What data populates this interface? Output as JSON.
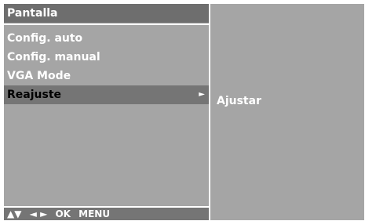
{
  "menu": {
    "title": "Pantalla",
    "items": [
      {
        "label": "Config. auto"
      },
      {
        "label": "Config. manual"
      },
      {
        "label": "VGA Mode"
      },
      {
        "label": "Reajuste",
        "selected": true
      }
    ]
  },
  "submenu": {
    "label": "Ajustar"
  },
  "footer": {
    "updown": "▲▼",
    "leftright": "◄ ►",
    "ok": "OK",
    "menu": "MENU"
  },
  "icons": {
    "submenu_arrow": "►"
  },
  "colors": {
    "panel": "#a5a5a5",
    "title_bar": "#6e6e6e",
    "selected_bar": "#757575",
    "text": "#ffffff",
    "selected_text": "#000000"
  }
}
